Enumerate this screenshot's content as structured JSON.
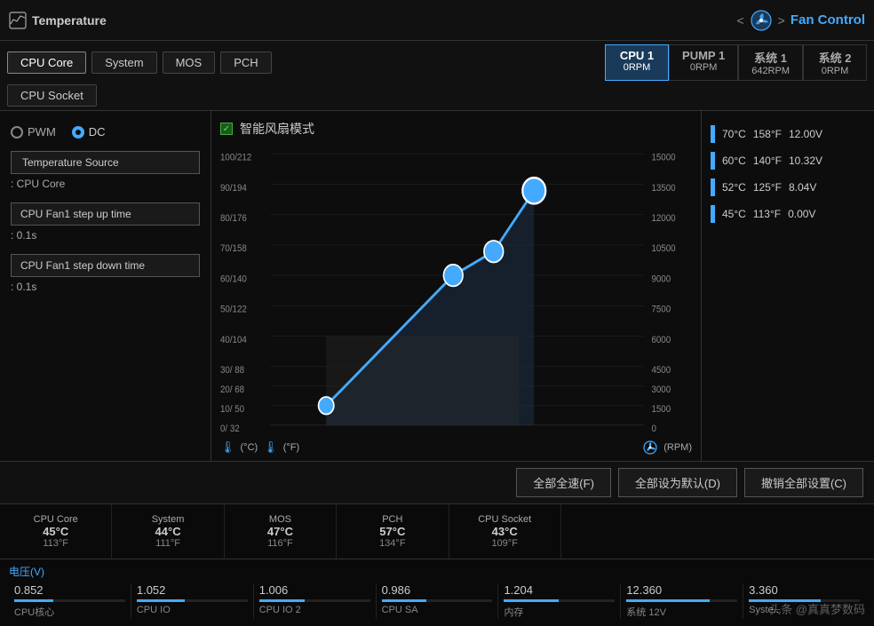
{
  "topBar": {
    "leftIcon": "📊",
    "title": "Temperature",
    "arrowLeft": "<",
    "fanIcon": "🌀",
    "arrowRight": ">",
    "fanControlLabel": "Fan Control"
  },
  "tempTabs": [
    {
      "label": "CPU Core",
      "active": true
    },
    {
      "label": "System",
      "active": false
    },
    {
      "label": "MOS",
      "active": false
    },
    {
      "label": "PCH",
      "active": false
    },
    {
      "label": "CPU Socket",
      "active": false
    }
  ],
  "fanTabs": [
    {
      "name": "CPU 1",
      "rpm": "0RPM",
      "active": true
    },
    {
      "name": "PUMP 1",
      "rpm": "0RPM",
      "active": false
    },
    {
      "name": "系统 1",
      "rpm": "642RPM",
      "active": false
    },
    {
      "name": "系统 2",
      "rpm": "0RPM",
      "active": false
    }
  ],
  "leftPanel": {
    "pwmLabel": "PWM",
    "dcLabel": "DC",
    "tempSourceLabel": "Temperature Source",
    "tempSourceValue": ": CPU Core",
    "stepUpLabel": "CPU Fan1 step up time",
    "stepUpValue": ": 0.1s",
    "stepDownLabel": "CPU Fan1 step down time",
    "stepDownValue": ": 0.1s"
  },
  "chart": {
    "checkboxChecked": "✓",
    "title": "智能风扇模式",
    "yAxisLabel": "(°C)",
    "yAxisLabel2": "(°F)",
    "rpmLabel": "(RPM)"
  },
  "legend": [
    {
      "temp_c": "70°C",
      "temp_f": "158°F",
      "voltage": "12.00V"
    },
    {
      "temp_c": "60°C",
      "temp_f": "140°F",
      "voltage": "10.32V"
    },
    {
      "temp_c": "52°C",
      "temp_f": "125°F",
      "voltage": "8.04V"
    },
    {
      "temp_c": "45°C",
      "temp_f": "113°F",
      "voltage": "0.00V"
    }
  ],
  "actionBar": {
    "btn1": "全部全速(F)",
    "btn2": "全部设为默认(D)",
    "btn3": "撤销全部设置(C)"
  },
  "statusItems": [
    {
      "name": "CPU Core",
      "celsius": "45°C",
      "fahrenheit": "113°F"
    },
    {
      "name": "System",
      "celsius": "44°C",
      "fahrenheit": "111°F"
    },
    {
      "name": "MOS",
      "celsius": "47°C",
      "fahrenheit": "116°F"
    },
    {
      "name": "PCH",
      "celsius": "57°C",
      "fahrenheit": "134°F"
    },
    {
      "name": "CPU Socket",
      "celsius": "43°C",
      "fahrenheit": "109°F"
    }
  ],
  "voltageLabel": "电压(V)",
  "voltageItems": [
    {
      "name": "CPU核心",
      "value": "0.852",
      "pct": 35
    },
    {
      "name": "CPU IO",
      "value": "1.052",
      "pct": 43
    },
    {
      "name": "CPU IO 2",
      "value": "1.006",
      "pct": 41
    },
    {
      "name": "CPU SA",
      "value": "0.986",
      "pct": 40
    },
    {
      "name": "内存",
      "value": "1.204",
      "pct": 49
    },
    {
      "name": "系统 12V",
      "value": "12.360",
      "pct": 75
    },
    {
      "name": "Syste...",
      "value": "3.360",
      "pct": 65
    }
  ],
  "watermark": "头条 @真真梦数码"
}
